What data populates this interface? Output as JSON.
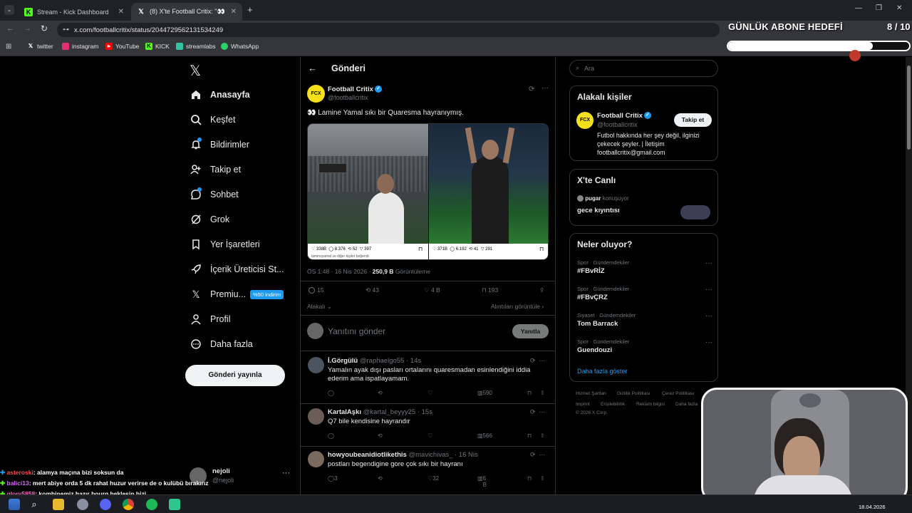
{
  "browser": {
    "tabs": [
      {
        "label": "Stream - Kick Dashboard",
        "icon": "kick-icon"
      },
      {
        "label": "(8) X'te Football Critix: \"👀 Lam",
        "icon": "x-icon"
      }
    ],
    "url": "x.com/footballcritix/status/2044729562131534249",
    "bookmarks": [
      "twitter",
      "instagram",
      "YouTube",
      "KICK",
      "streamlabs",
      "WhatsApp"
    ]
  },
  "nav": {
    "items": [
      {
        "label": "Anasayfa",
        "icon": "home-icon"
      },
      {
        "label": "Keşfet",
        "icon": "search-icon"
      },
      {
        "label": "Bildirimler",
        "icon": "bell-icon"
      },
      {
        "label": "Takip et",
        "icon": "follow-icon"
      },
      {
        "label": "Sohbet",
        "icon": "chat-icon"
      },
      {
        "label": "Grok",
        "icon": "grok-icon"
      },
      {
        "label": "Yer İşaretleri",
        "icon": "bookmark-icon"
      },
      {
        "label": "İçerik Üreticisi St...",
        "icon": "rocket-icon"
      },
      {
        "label": "Premiu...",
        "icon": "x-logo-icon"
      },
      {
        "label": "Profil",
        "icon": "profile-icon"
      },
      {
        "label": "Daha fazla",
        "icon": "more-icon"
      }
    ],
    "premium_badge": "%50 indirim",
    "post_button": "Gönderi yayınla",
    "account_name": "nejoli",
    "account_handle": "@nejoli"
  },
  "post": {
    "header": "Gönderi",
    "author": "Football Critix",
    "handle": "@footballcritix",
    "avatar_text": "FCX",
    "text": "👀 Lamine Yamal sıkı bir Quaresma hayranıymış.",
    "meta_time": "ÖS 1:48 · 16 Nis 2026 · ",
    "views_value": "250,9 B",
    "views_label": " Görüntüleme",
    "stats": {
      "replies": "15",
      "reposts": "43",
      "likes": "4 B",
      "bookmarks": "193"
    },
    "sort_label": "Alakalı",
    "quotes_link": "Alıntıları görüntüle",
    "reply_placeholder": "Yanıtını gönder",
    "reply_button": "Yanıtla",
    "image_left": {
      "likes": "338B",
      "replies": "8.376",
      "reposts": "52",
      "views": "397",
      "caption": "laminoyamal ve diğer kişiler beğendi"
    },
    "image_right": {
      "likes": "371B",
      "replies": "6.192",
      "reposts": "41",
      "views": "291"
    }
  },
  "replies": [
    {
      "name": "İ.Görgülü",
      "handle": "@raphaelgo55",
      "time": "· 14s",
      "text": "Yamalın ayak dışı pasları ortalarını quaresmadan esinlendiğini iddia ederim ama ispatlayamam.",
      "replies": "",
      "reposts": "",
      "likes": "",
      "views": "590"
    },
    {
      "name": "KartalAşkı",
      "handle": "@kartal_beyyy25",
      "time": "· 15s",
      "text": "Q7 bile kendisine hayrandır",
      "replies": "",
      "reposts": "",
      "likes": "",
      "views": "566"
    },
    {
      "name": "howyoubeanidiotlikethis",
      "handle": "@mavichivas_",
      "time": "· 16 Nis",
      "text": "postları begendigine gore çok sıkı bir hayranı",
      "replies": "3",
      "reposts": "",
      "likes": "32",
      "views": "6 B"
    }
  ],
  "sidebar": {
    "search_placeholder": "Ara",
    "relevant_title": "Alakalı kişiler",
    "relevant": {
      "name": "Football Critix",
      "handle": "@footballcritix",
      "bio": "Futbol hakkında her şey değil, ilginizi çekecek şeyler. | İletişim footballcritix@gmail.com",
      "follow_button": "Takip et"
    },
    "live_title": "X'te Canlı",
    "live": {
      "host": "pugar",
      "status": "konuşuyor",
      "title": "gece kıyıntısı"
    },
    "trends_title": "Neler oluyor?",
    "trends": [
      {
        "category": "Spor · Gündemdekiler",
        "name": "#FBvRİZ"
      },
      {
        "category": "Spor · Gündemdekiler",
        "name": "#FBvÇRZ"
      },
      {
        "category": "Siyaset · Gündemdekiler",
        "name": "Tom Barrack"
      },
      {
        "category": "Spor · Gündemdekiler",
        "name": "Guendouzi"
      }
    ],
    "show_more": "Daha fazla göster",
    "footer": [
      "Hizmet Şartları",
      "Gizlilik Politikası",
      "Çerez Politikası",
      "Imprint",
      "Erişilebilirlik",
      "Reklam bilgisi",
      "Daha fazla",
      "© 2026 X Corp."
    ]
  },
  "overlay": {
    "goal_title": "GÜNLÜK ABONE HEDEFİ",
    "goal_count": "8 / 10",
    "goal_progress": 0.8,
    "chat": [
      {
        "user": "asteroski",
        "message": ": alamya maçına bizi soksun da",
        "color": "#ff4d4d"
      },
      {
        "user": "balici13",
        "message": ": mert abiye orda 5 dk rahat huzur verirse de o kulübü bırakırız",
        "color": "#d966ff"
      },
      {
        "user": "glory5858",
        "message": ": kombinemiz hazır bourg beklesin bizi",
        "color": "#ff66cc"
      }
    ]
  },
  "taskbar": {
    "date": "18.04.2026"
  },
  "colors": {
    "accent": "#1d9bf0",
    "background": "#000000",
    "border": "#2f3336",
    "muted": "#71767b"
  }
}
